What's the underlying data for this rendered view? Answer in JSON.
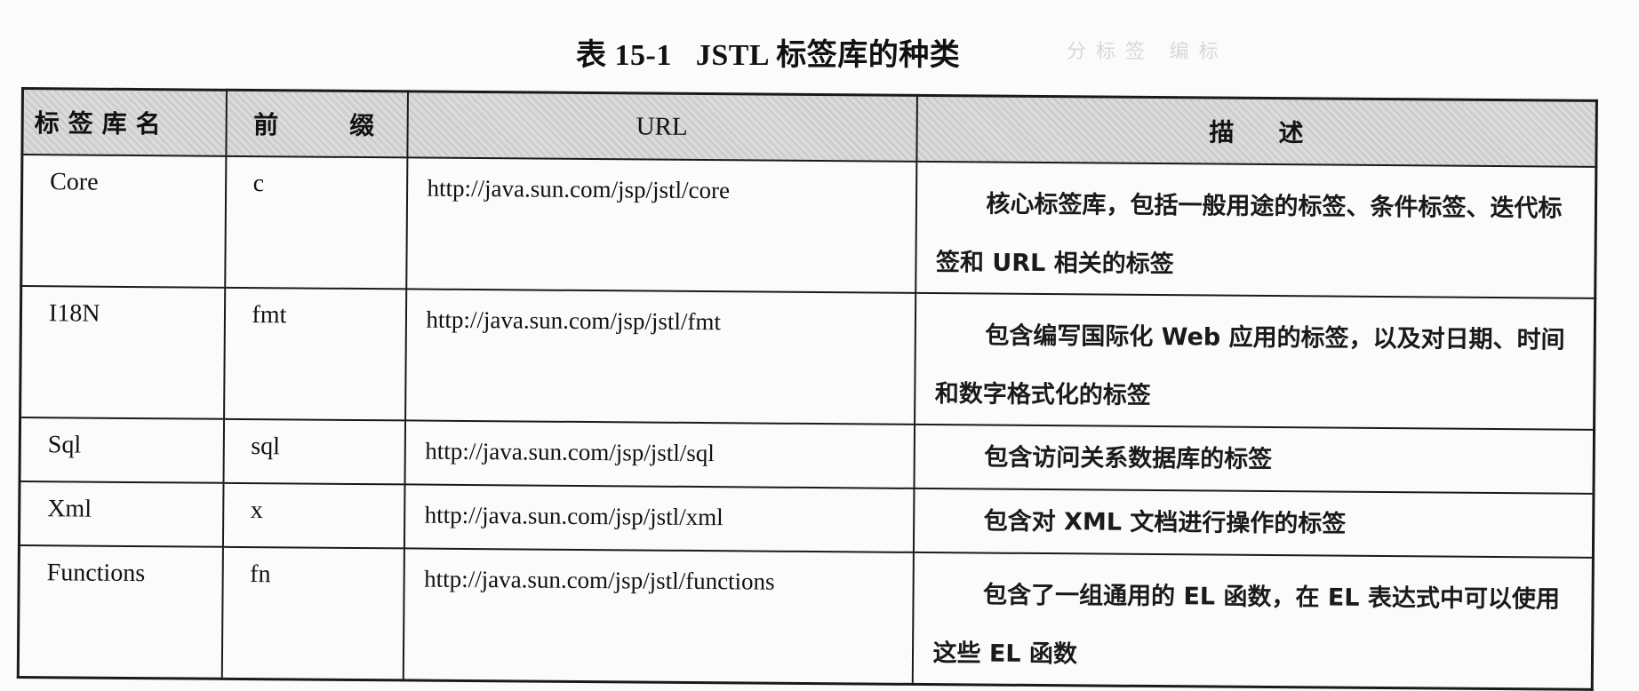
{
  "title": "表 15-1   JSTL 标签库的种类",
  "ghost_text": "分  标  签     编  标",
  "table": {
    "headers": {
      "name": "标签库名",
      "prefix_a": "前",
      "prefix_b": "缀",
      "url": "URL",
      "desc_a": "描",
      "desc_b": "述"
    },
    "rows": [
      {
        "name": "Core",
        "prefix": "c",
        "url": "http://java.sun.com/jsp/jstl/core",
        "description": "核心标签库，包括一般用途的标签、条件标签、迭代标签和 URL 相关的标签"
      },
      {
        "name": "I18N",
        "prefix": "fmt",
        "url": "http://java.sun.com/jsp/jstl/fmt",
        "description": "包含编写国际化 Web 应用的标签，以及对日期、时间和数字格式化的标签"
      },
      {
        "name": "Sql",
        "prefix": "sql",
        "url": "http://java.sun.com/jsp/jstl/sql",
        "description": "包含访问关系数据库的标签"
      },
      {
        "name": "Xml",
        "prefix": "x",
        "url": "http://java.sun.com/jsp/jstl/xml",
        "description": "包含对 XML 文档进行操作的标签"
      },
      {
        "name": "Functions",
        "prefix": "fn",
        "url": "http://java.sun.com/jsp/jstl/functions",
        "description": "包含了一组通用的 EL 函数，在 EL 表达式中可以使用这些 EL 函数"
      }
    ]
  }
}
